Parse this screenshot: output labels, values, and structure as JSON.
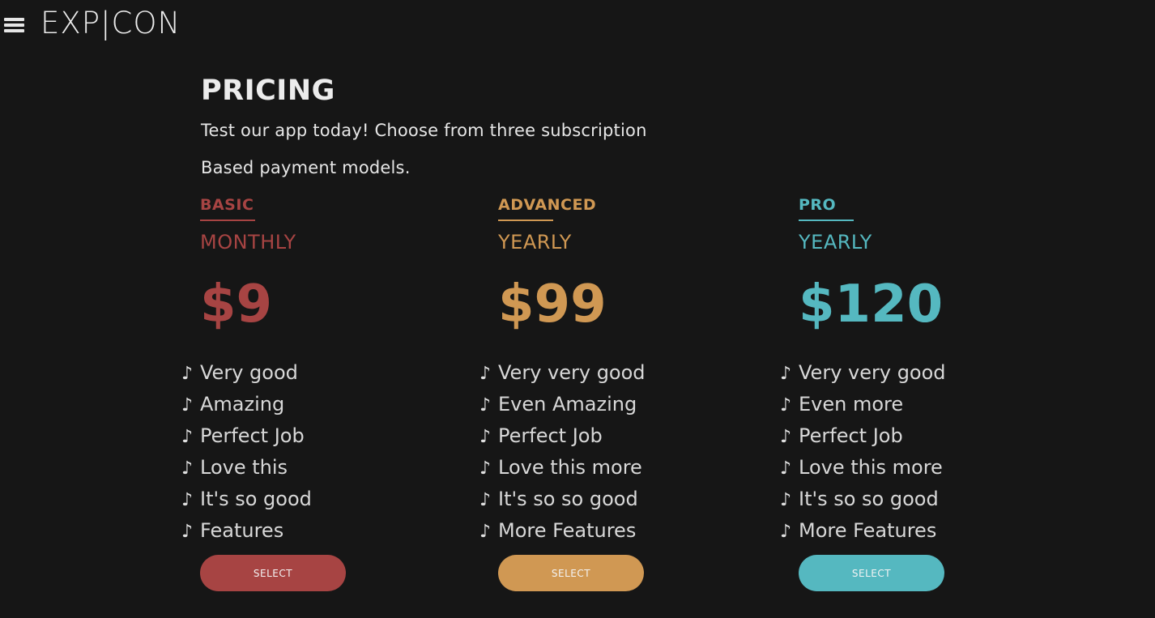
{
  "header": {
    "logo": "EXP|CON",
    "menu_icon": "hamburger-menu-icon"
  },
  "intro": {
    "title": "PRICING",
    "subtitle_line1": "Test our app today! Choose from three subscription",
    "subtitle_line2": "Based payment models."
  },
  "plans": [
    {
      "tier": "BASIC",
      "period": "MONTHLY",
      "price": "$9",
      "color": "#a74443",
      "features": [
        "Very good",
        "Amazing",
        "Perfect Job",
        "Love this",
        "It's so good",
        "Features"
      ],
      "button_label": "SELECT"
    },
    {
      "tier": "ADVANCED",
      "period": "YEARLY",
      "price": "$99",
      "color": "#d09853",
      "features": [
        "Very very good",
        "Even Amazing",
        "Perfect Job",
        "Love this more",
        "It's so so good",
        "More Features"
      ],
      "button_label": "SELECT"
    },
    {
      "tier": "PRO",
      "period": "YEARLY",
      "price": "$120",
      "color": "#55b8c0",
      "features": [
        "Very very good",
        "Even more",
        "Perfect Job",
        "Love this more",
        "It's so so good",
        "More Features"
      ],
      "button_label": "SELECT"
    }
  ],
  "feature_bullet": "♪",
  "feature_bullet_icon": "music-note-icon"
}
